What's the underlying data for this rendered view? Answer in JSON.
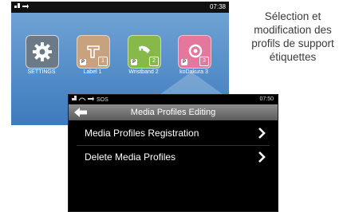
{
  "home_screen": {
    "status_time": "07:38",
    "apps": [
      {
        "label": "SETTINGS",
        "icon": "gear-icon",
        "color": "#6c7a88",
        "badge": ""
      },
      {
        "label": "Label 1",
        "icon": "label-icon",
        "color": "#c8a27f",
        "badge": "1"
      },
      {
        "label": "Wristband 2",
        "icon": "wristband-icon",
        "color": "#86b84a",
        "badge": "2"
      },
      {
        "label": "koDakura 3",
        "icon": "ribbon-icon",
        "color": "#e3779c",
        "badge": "3"
      }
    ]
  },
  "profiles_screen": {
    "status_text": "SOS",
    "status_time": "07:50",
    "title": "Media Profiles Editing",
    "menu": [
      {
        "label": "Media Profiles Registration"
      },
      {
        "label": "Delete Media Profiles"
      }
    ]
  },
  "caption": {
    "lines": [
      "Sélection et",
      "modification des",
      "profils de support",
      "étiquettes"
    ]
  },
  "colors": {
    "home_bg_top": "#6ea2d4",
    "home_bg_bottom": "#3e7bbd",
    "header_grey": "#8e8e8e"
  }
}
